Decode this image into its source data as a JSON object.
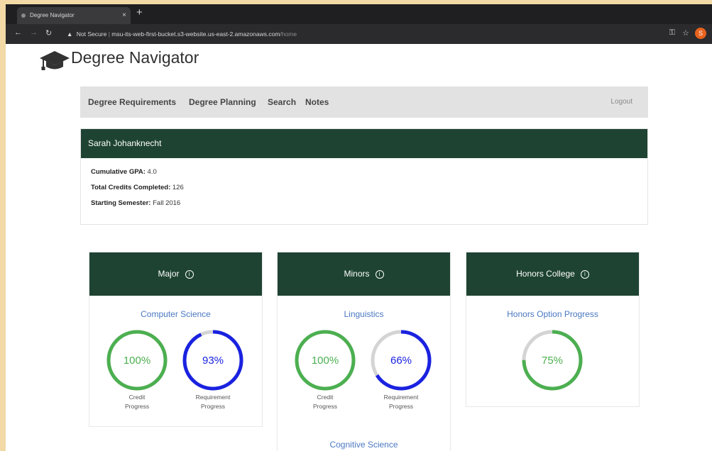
{
  "browser": {
    "tab_title": "Degree Navigator",
    "tab_close": "×",
    "new_tab": "+",
    "security": "Not Secure",
    "url_host": "msu-its-web-first-bucket.s3-website.us-east-2.amazonaws.com",
    "url_path": "/home",
    "profile_initial": "S"
  },
  "app": {
    "title": "Degree Navigator"
  },
  "nav": {
    "items": [
      "Degree Requirements",
      "Degree Planning",
      "Search",
      "Notes"
    ],
    "logout": "Logout"
  },
  "student": {
    "name": "Sarah Johanknecht",
    "gpa_label": "Cumulative GPA:",
    "gpa_value": "4.0",
    "credits_label": "Total Credits Completed:",
    "credits_value": "126",
    "start_label": "Starting Semester:",
    "start_value": "Fall 2016"
  },
  "panels": {
    "major": {
      "title": "Major",
      "program": "Computer Science",
      "credit": {
        "percent": 100,
        "text": "100%",
        "label_1": "Credit",
        "label_2": "Progress"
      },
      "requirement": {
        "percent": 93,
        "text": "93%",
        "label_1": "Requirement",
        "label_2": "Progress"
      }
    },
    "minors": {
      "title": "Minors",
      "program": "Linguistics",
      "credit": {
        "percent": 100,
        "text": "100%",
        "label_1": "Credit",
        "label_2": "Progress"
      },
      "requirement": {
        "percent": 66,
        "text": "66%",
        "label_1": "Requirement",
        "label_2": "Progress"
      },
      "second_program": "Cognitive Science"
    },
    "honors": {
      "title": "Honors College",
      "program": "Honors Option Progress",
      "option": {
        "percent": 75,
        "text": "75%"
      }
    }
  },
  "colors": {
    "primary": "#1e4332",
    "green": "#4caf50",
    "blue": "#1a22e0",
    "track": "#d4d4d4",
    "link": "#4a78c2"
  }
}
